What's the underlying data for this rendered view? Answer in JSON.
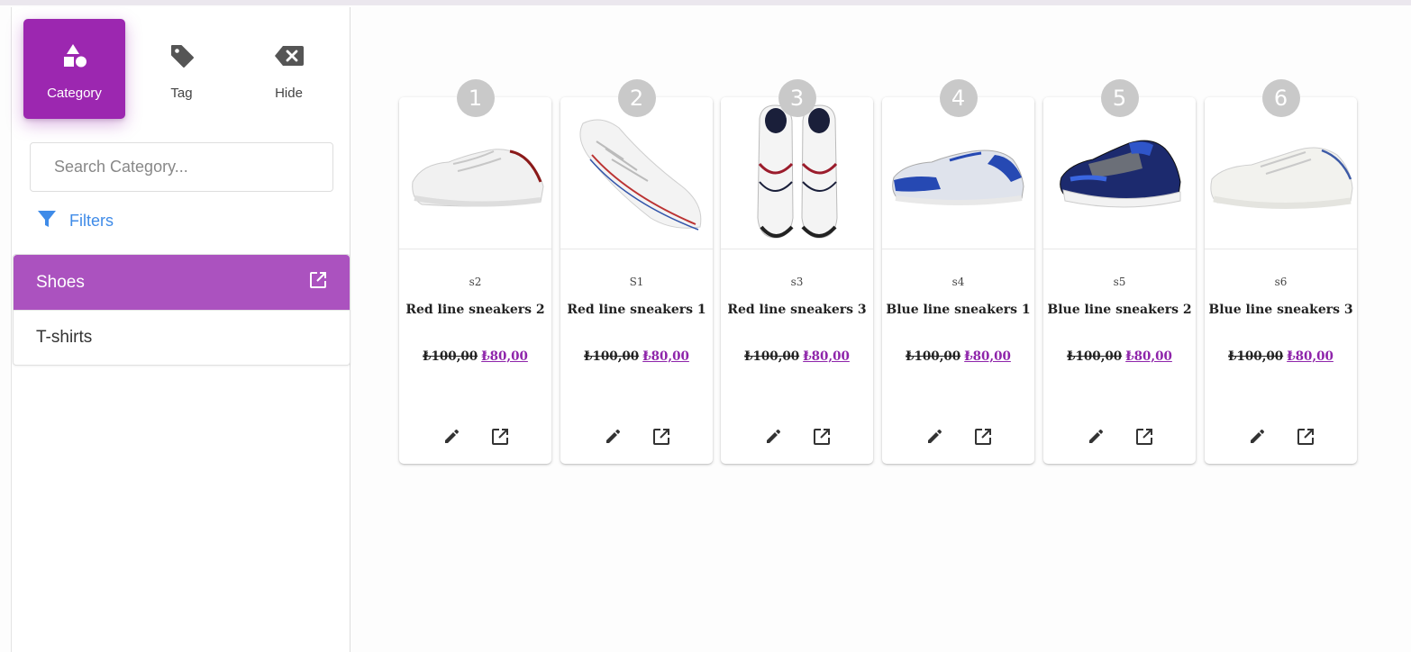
{
  "sidebar": {
    "modes": [
      {
        "label": "Category",
        "icon": "shapes-icon",
        "active": true
      },
      {
        "label": "Tag",
        "icon": "tag-icon",
        "active": false
      },
      {
        "label": "Hide",
        "icon": "backspace-icon",
        "active": false
      }
    ],
    "search": {
      "placeholder": "Search Category..."
    },
    "filters_label": "Filters",
    "categories": [
      {
        "label": "Shoes",
        "active": true,
        "icon": "open-in-new-icon"
      },
      {
        "label": "T-shirts",
        "active": false
      }
    ]
  },
  "products": [
    {
      "position": "1",
      "code": "s2",
      "name": "Red line sneakers 2",
      "old_price": "₺100,00",
      "new_price": "₺80,00"
    },
    {
      "position": "2",
      "code": "S1",
      "name": "Red line sneakers 1",
      "old_price": "₺100,00",
      "new_price": "₺80,00"
    },
    {
      "position": "3",
      "code": "s3",
      "name": "Red line sneakers 3",
      "old_price": "₺100,00",
      "new_price": "₺80,00"
    },
    {
      "position": "4",
      "code": "s4",
      "name": "Blue line sneakers 1",
      "old_price": "₺100,00",
      "new_price": "₺80,00"
    },
    {
      "position": "5",
      "code": "s5",
      "name": "Blue line sneakers 2",
      "old_price": "₺100,00",
      "new_price": "₺80,00"
    },
    {
      "position": "6",
      "code": "s6",
      "name": "Blue line sneakers 3",
      "old_price": "₺100,00",
      "new_price": "₺80,00"
    }
  ],
  "colors": {
    "accent": "#9c27b0",
    "active_category": "#ab52bf",
    "link": "#3f8be8",
    "price": "#8e24aa"
  }
}
